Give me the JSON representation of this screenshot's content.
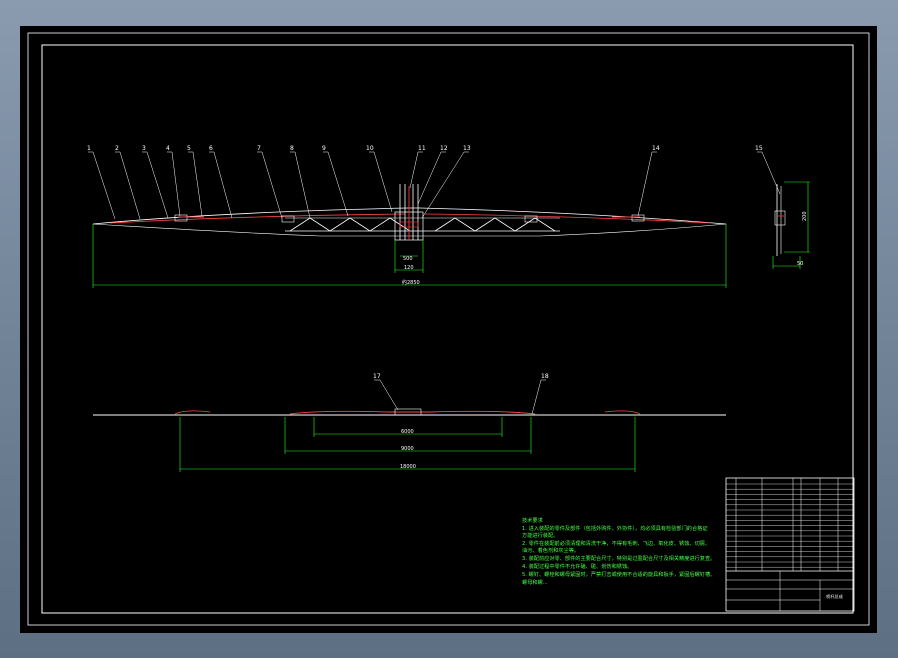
{
  "drawing": {
    "top_view": {
      "balloons": [
        "1",
        "2",
        "3",
        "4",
        "5",
        "6",
        "7",
        "8",
        "9",
        "10",
        "11",
        "12",
        "13",
        "14",
        "15"
      ],
      "dims": {
        "overall": "约2850",
        "center_1": "500",
        "center_2": "120",
        "side_height": "200",
        "side_width": "50"
      }
    },
    "bottom_view": {
      "balloons": [
        "17",
        "18"
      ],
      "dims": {
        "inner": "6000",
        "middle": "9000",
        "outer": "18000"
      }
    },
    "notes": {
      "title": "技术要求",
      "lines": [
        "1. 进入装配的零件及部件（包括外购件、外协件），均必须具有检验部门的合格证",
        "   方能进行装配。",
        "2. 零件在装配前必须清理和清洗干净，不得有毛刺、飞边、氧化皮、锈蚀、切屑、",
        "   油污、着色剂和灰尘等。",
        "3. 装配前应对零、部件的主要配合尺寸，特别是过盈配合尺寸及相关精度进行复查。",
        "4. 装配过程中零件不允许磕、碰、划伤和锈蚀。",
        "5. 螺钉、螺栓和螺母紧固时，严禁打击或使用不合适的旋具和扳手，紧固后螺钉槽、",
        "   螺母和螺..."
      ]
    },
    "title_block": {
      "drawing_title": "喷杆总成"
    },
    "colors": {
      "lines": "#ffffff",
      "parts": "#ff3333",
      "dimensions": "#22ff22",
      "leaders": "#ffffff"
    }
  }
}
